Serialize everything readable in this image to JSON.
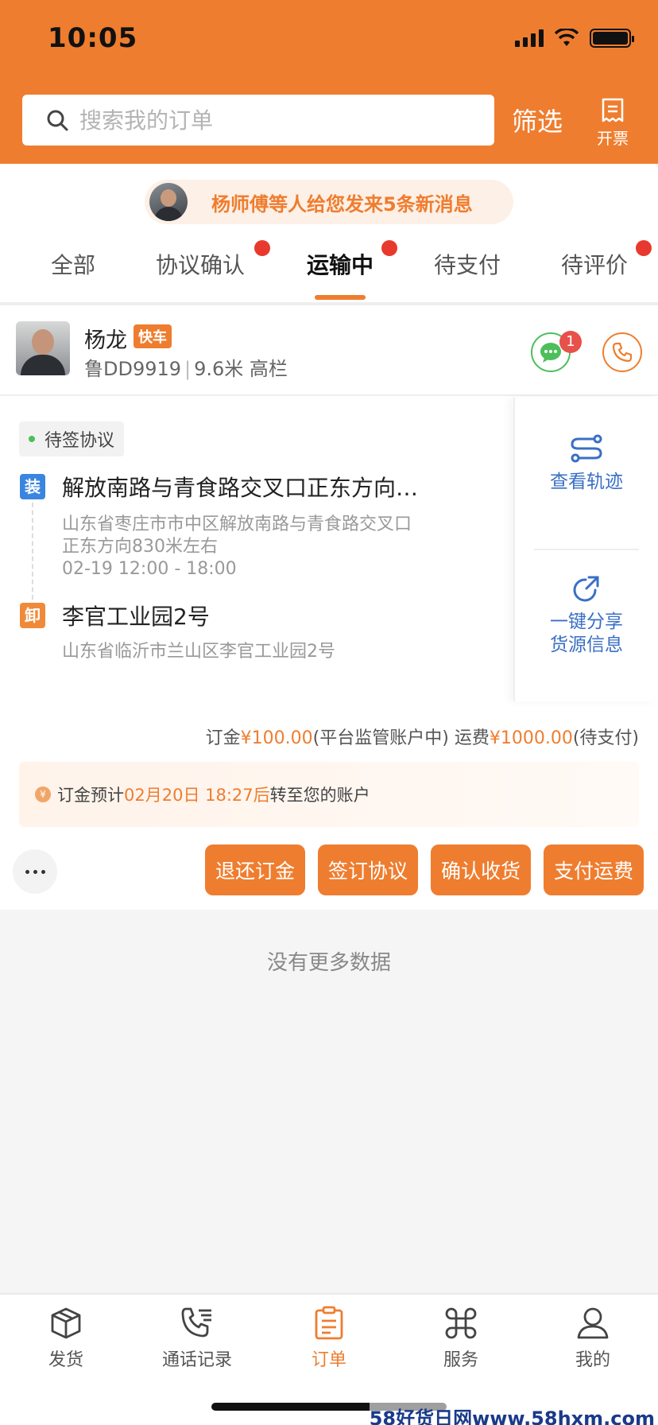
{
  "status_bar": {
    "time": "10:05"
  },
  "header": {
    "search_placeholder": "搜索我的订单",
    "filter_label": "筛选",
    "invoice_label": "开票"
  },
  "message_bar": {
    "text": "杨师傅等人给您发来5条新消息"
  },
  "tabs": [
    {
      "label": "全部",
      "dot": false
    },
    {
      "label": "协议确认",
      "dot": true
    },
    {
      "label": "运输中",
      "dot": true,
      "active": true
    },
    {
      "label": "待支付",
      "dot": false
    },
    {
      "label": "待评价",
      "dot": true
    }
  ],
  "order": {
    "driver_name": "杨龙",
    "badge": "快车",
    "plate": "鲁DD9919",
    "truck_info": "9.6米 高栏",
    "chat_unread": "1",
    "status_tag": "待签协议",
    "load": {
      "icon": "装",
      "title": "解放南路与青食路交叉口正东方向…",
      "address_line1": "山东省枣庄市市中区解放南路与青食路交叉口",
      "address_line2": "正东方向830米左右",
      "time": "02-19 12:00 - 18:00"
    },
    "unload": {
      "icon": "卸",
      "title": "李官工业园2号",
      "address": "山东省临沂市兰山区李官工业园2号"
    },
    "side": {
      "track_label": "查看轨迹",
      "share_line1": "一键分享",
      "share_line2": "货源信息"
    },
    "fees": {
      "deposit_label": "订金",
      "deposit_amount": "¥100.00",
      "deposit_note": "(平台监管账户中)",
      "freight_label": "运费",
      "freight_amount": "¥1000.00",
      "freight_note": "(待支付)"
    },
    "notice": {
      "coin": "¥",
      "prefix": "订金预计",
      "time": "02月20日 18:27后",
      "suffix": "转至您的账户"
    },
    "actions": [
      "退还订金",
      "签订协议",
      "确认收货",
      "支付运费"
    ]
  },
  "list_end_text": "没有更多数据",
  "bottom_nav": [
    {
      "label": "发货",
      "icon": "box-icon"
    },
    {
      "label": "通话记录",
      "icon": "phone-list-icon"
    },
    {
      "label": "订单",
      "icon": "clipboard-icon",
      "active": true
    },
    {
      "label": "服务",
      "icon": "command-icon"
    },
    {
      "label": "我的",
      "icon": "user-icon"
    }
  ],
  "watermark": "58好货日网www.58hxm.com",
  "colors": {
    "brand": "#ef7d2f",
    "link": "#3a6fc4",
    "alert": "#e8392e"
  }
}
